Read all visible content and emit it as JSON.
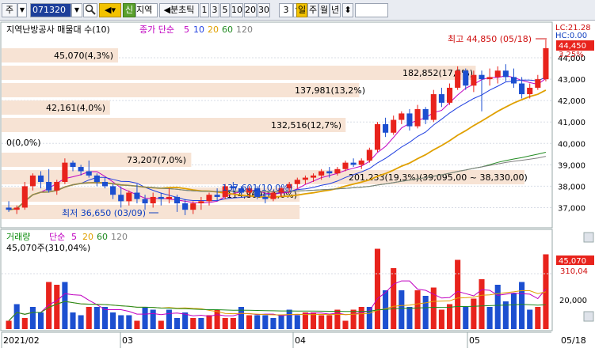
{
  "toolbar": {
    "market": "주",
    "code": "071320",
    "credit": "신",
    "name": "지역",
    "period_nav": "◀분초틱",
    "intervals": [
      "1",
      "3",
      "5",
      "10",
      "20",
      "30"
    ],
    "count": "3",
    "period_buttons": [
      "일",
      "주",
      "월",
      "년"
    ],
    "updown": "⬍"
  },
  "price_panel": {
    "legend": {
      "name": "지역난방공사 매물대 수(10)",
      "ma_label": "종가 단순",
      "ma_periods": [
        "5",
        "10",
        "20",
        "60",
        "120"
      ],
      "ma_colors": [
        "#c000c0",
        "#1f3fe0",
        "#e0a000",
        "#208a20",
        "#808080"
      ]
    },
    "axis_labels": [
      "44,000",
      "43,000",
      "42,000",
      "41,000",
      "40,000",
      "39,000",
      "38,000",
      "37,000"
    ],
    "top_right": {
      "lc": "LC:21.28",
      "hc": "HC:0.00",
      "price": "44,450",
      "pct": "3.25%"
    },
    "volume_profile": [
      {
        "label": "45,070(4,3%)",
        "pct": 4.3
      },
      {
        "label": "182,852(17,5%)",
        "pct": 17.5
      },
      {
        "label": "137,981(13,2%)",
        "pct": 13.2
      },
      {
        "label": "42,161(4,0%)",
        "pct": 4.0
      },
      {
        "label": "132,516(12,7%)",
        "pct": 12.7
      },
      {
        "label": "0(0,0%)",
        "pct": 0.0
      },
      {
        "label": "73,207(7,0%)",
        "pct": 7.0
      },
      {
        "label": "201,233(19,3%)(39,095,00 ~ 38,330,00)",
        "pct": 19.3
      },
      {
        "label": "114,869(11,0%)",
        "pct": 11.0
      },
      {
        "label": "",
        "pct": 11.0
      }
    ],
    "high_label": "최고 44,850 (05/18)",
    "low_label": "최저 36,650 (03/09)",
    "overlap_label": "137,601(10,0%)"
  },
  "volume_panel": {
    "legend": {
      "name": "거래량",
      "ma_label": "단순",
      "periods": [
        "5",
        "20",
        "60",
        "120"
      ]
    },
    "value": "45,070주(310,04%)",
    "axis_labels": [
      "20,000"
    ],
    "badge_value": "45,070",
    "badge_pct": "310,04"
  },
  "x_axis": [
    "2021/02",
    "03",
    "04",
    "05",
    "05/18"
  ],
  "colors": {
    "up": "#e8231c",
    "down": "#1c4fd0",
    "profile": "#f7e3d4",
    "toolbar": "#e9ecf2"
  },
  "chart_data": {
    "type": "candlestick",
    "title": "지역난방공사",
    "ylim": [
      36500,
      45000
    ],
    "candles": [
      [
        37000,
        37300,
        36800,
        36900
      ],
      [
        36900,
        37100,
        36700,
        37000
      ],
      [
        37000,
        38200,
        36900,
        38000
      ],
      [
        38000,
        38600,
        37800,
        38500
      ],
      [
        38500,
        38700,
        37900,
        38200
      ],
      [
        38200,
        38800,
        37700,
        37800
      ],
      [
        37800,
        38300,
        37600,
        38200
      ],
      [
        38200,
        39300,
        38100,
        39100
      ],
      [
        39100,
        39200,
        38700,
        38900
      ],
      [
        38900,
        39000,
        38500,
        38700
      ],
      [
        38700,
        39200,
        38400,
        38500
      ],
      [
        38500,
        38600,
        38000,
        38200
      ],
      [
        38200,
        38400,
        37900,
        38000
      ],
      [
        38000,
        38100,
        37400,
        37600
      ],
      [
        37600,
        38000,
        37000,
        37300
      ],
      [
        37300,
        37800,
        37100,
        37700
      ],
      [
        37700,
        38100,
        37200,
        37400
      ],
      [
        37400,
        37600,
        36900,
        37200
      ],
      [
        37200,
        37700,
        37000,
        37500
      ],
      [
        37500,
        37700,
        37100,
        37400
      ],
      [
        37400,
        37900,
        37200,
        37500
      ],
      [
        37500,
        37600,
        36800,
        37200
      ],
      [
        37200,
        37400,
        36650,
        36900
      ],
      [
        36900,
        37300,
        36700,
        37200
      ],
      [
        37200,
        37500,
        36900,
        37300
      ],
      [
        37300,
        37700,
        37100,
        37600
      ],
      [
        37600,
        37900,
        37300,
        37500
      ],
      [
        37500,
        38100,
        37400,
        38000
      ],
      [
        38000,
        38200,
        37700,
        37900
      ],
      [
        37900,
        38000,
        37600,
        37700
      ],
      [
        37700,
        38000,
        37500,
        37900
      ],
      [
        37900,
        38000,
        37400,
        37500
      ],
      [
        37500,
        37700,
        37200,
        37400
      ],
      [
        37400,
        37800,
        37300,
        37700
      ],
      [
        37700,
        38000,
        37500,
        37900
      ],
      [
        37900,
        38200,
        37700,
        38100
      ],
      [
        38100,
        38400,
        37900,
        38300
      ],
      [
        38300,
        38500,
        38100,
        38400
      ],
      [
        38400,
        38600,
        38200,
        38500
      ],
      [
        38500,
        38800,
        38300,
        38700
      ],
      [
        38700,
        38900,
        38400,
        38600
      ],
      [
        38600,
        38900,
        38500,
        38800
      ],
      [
        38800,
        39200,
        38700,
        39100
      ],
      [
        39100,
        39300,
        38900,
        39000
      ],
      [
        39000,
        39300,
        38800,
        39200
      ],
      [
        39200,
        39800,
        39100,
        39700
      ],
      [
        39700,
        41000,
        39600,
        40900
      ],
      [
        40900,
        41200,
        40300,
        40500
      ],
      [
        40500,
        41300,
        40400,
        41100
      ],
      [
        41100,
        41500,
        40900,
        41400
      ],
      [
        41400,
        41600,
        40600,
        40800
      ],
      [
        40800,
        41800,
        40700,
        41600
      ],
      [
        41600,
        41700,
        40900,
        41100
      ],
      [
        41100,
        42500,
        41000,
        42300
      ],
      [
        42300,
        42600,
        41700,
        41900
      ],
      [
        41900,
        42800,
        41800,
        42600
      ],
      [
        42600,
        43600,
        42500,
        43400
      ],
      [
        43400,
        43500,
        42500,
        42700
      ],
      [
        42700,
        43400,
        42400,
        43200
      ],
      [
        43200,
        43400,
        41500,
        43000
      ],
      [
        43000,
        43500,
        42700,
        43100
      ],
      [
        43100,
        43600,
        42800,
        43400
      ],
      [
        43400,
        43700,
        42900,
        43100
      ],
      [
        43100,
        43500,
        42600,
        42800
      ],
      [
        42800,
        43100,
        42100,
        42300
      ],
      [
        42300,
        42800,
        42100,
        42600
      ],
      [
        42600,
        43200,
        42500,
        43000
      ],
      [
        43000,
        44850,
        42900,
        44450
      ]
    ],
    "volume": [
      [
        3000,
        "up"
      ],
      [
        9000,
        "down"
      ],
      [
        4000,
        "up"
      ],
      [
        8000,
        "down"
      ],
      [
        6000,
        "down"
      ],
      [
        17000,
        "up"
      ],
      [
        16000,
        "up"
      ],
      [
        17000,
        "down"
      ],
      [
        6000,
        "down"
      ],
      [
        5000,
        "down"
      ],
      [
        8000,
        "up"
      ],
      [
        8000,
        "down"
      ],
      [
        8000,
        "down"
      ],
      [
        6000,
        "down"
      ],
      [
        5000,
        "down"
      ],
      [
        5000,
        "down"
      ],
      [
        3000,
        "up"
      ],
      [
        8000,
        "down"
      ],
      [
        7000,
        "down"
      ],
      [
        3000,
        "up"
      ],
      [
        7000,
        "down"
      ],
      [
        4000,
        "down"
      ],
      [
        6000,
        "down"
      ],
      [
        4000,
        "up"
      ],
      [
        4000,
        "down"
      ],
      [
        5000,
        "up"
      ],
      [
        7000,
        "up"
      ],
      [
        4000,
        "up"
      ],
      [
        4000,
        "up"
      ],
      [
        8000,
        "down"
      ],
      [
        5000,
        "up"
      ],
      [
        5000,
        "down"
      ],
      [
        5000,
        "down"
      ],
      [
        4000,
        "down"
      ],
      [
        5000,
        "down"
      ],
      [
        7000,
        "down"
      ],
      [
        5000,
        "down"
      ],
      [
        6000,
        "up"
      ],
      [
        6000,
        "up"
      ],
      [
        5000,
        "up"
      ],
      [
        5000,
        "up"
      ],
      [
        7000,
        "up"
      ],
      [
        3000,
        "up"
      ],
      [
        7000,
        "up"
      ],
      [
        8000,
        "up"
      ],
      [
        8000,
        "down"
      ],
      [
        29000,
        "up"
      ],
      [
        14000,
        "down"
      ],
      [
        22000,
        "up"
      ],
      [
        14000,
        "down"
      ],
      [
        8000,
        "down"
      ],
      [
        14000,
        "up"
      ],
      [
        12000,
        "down"
      ],
      [
        15000,
        "up"
      ],
      [
        7000,
        "up"
      ],
      [
        9000,
        "up"
      ],
      [
        25000,
        "up"
      ],
      [
        8000,
        "down"
      ],
      [
        11000,
        "up"
      ],
      [
        18000,
        "up"
      ],
      [
        8000,
        "down"
      ],
      [
        16000,
        "down"
      ],
      [
        10000,
        "down"
      ],
      [
        13000,
        "down"
      ],
      [
        17000,
        "down"
      ],
      [
        7000,
        "down"
      ],
      [
        8000,
        "up"
      ],
      [
        27000,
        "up"
      ]
    ]
  }
}
